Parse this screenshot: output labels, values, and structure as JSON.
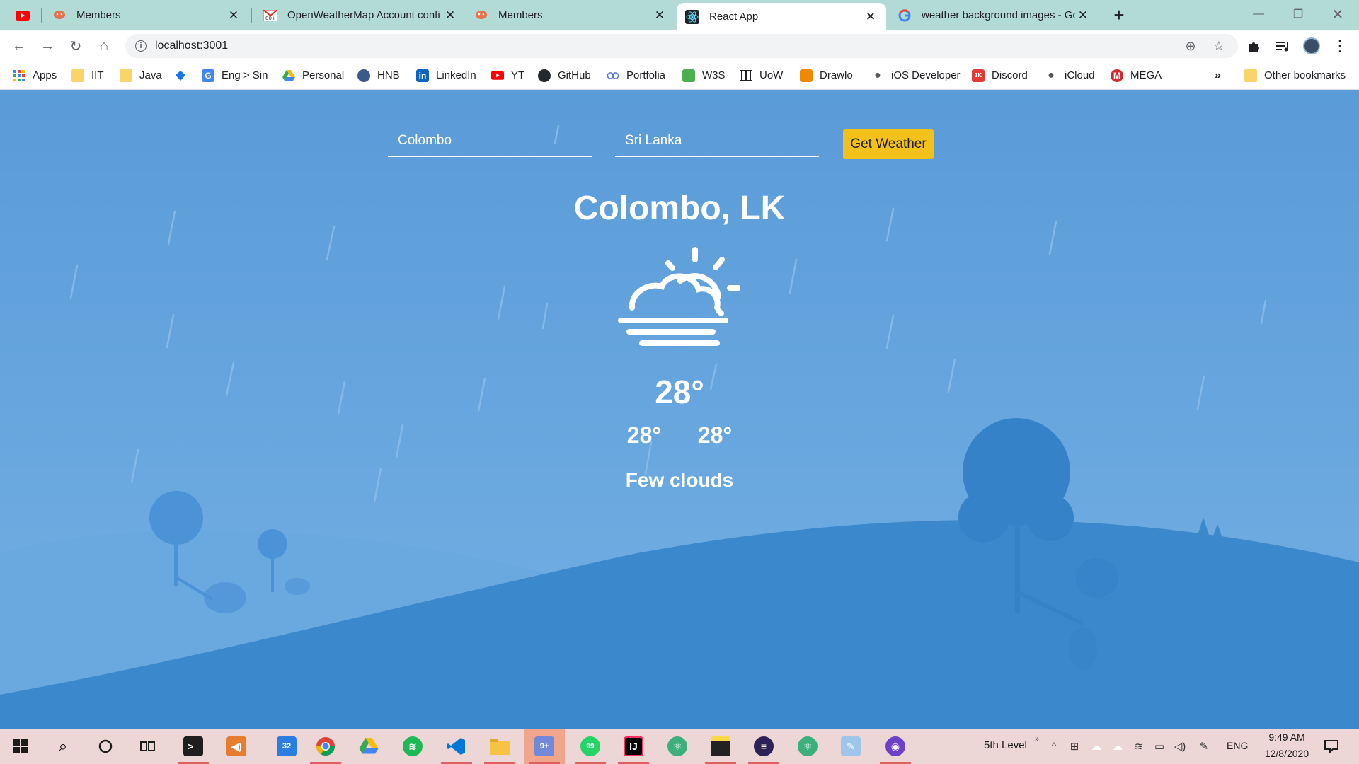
{
  "browser": {
    "tabs": [
      {
        "title": "Members",
        "favicon": "octopus-icon",
        "active": false
      },
      {
        "title": "OpenWeatherMap Account confi",
        "favicon": "gmail-icon",
        "active": false
      },
      {
        "title": "Members",
        "favicon": "octopus-icon",
        "active": false
      },
      {
        "title": "React App",
        "favicon": "react-icon",
        "active": true
      },
      {
        "title": "weather background images - Go",
        "favicon": "google-icon",
        "active": false
      }
    ],
    "address": "localhost:3001"
  },
  "bookmarks": [
    {
      "label": "Apps",
      "icon": "apps-grid-icon"
    },
    {
      "label": "IIT",
      "icon": "folder-icon"
    },
    {
      "label": "Java",
      "icon": "folder-icon"
    },
    {
      "label": "",
      "icon": "diamond-icon"
    },
    {
      "label": "Eng > Sin",
      "icon": "translate-icon"
    },
    {
      "label": "Personal",
      "icon": "google-drive-icon"
    },
    {
      "label": "HNB",
      "icon": "hnb-icon"
    },
    {
      "label": "LinkedIn",
      "icon": "linkedin-icon"
    },
    {
      "label": "YT",
      "icon": "youtube-icon"
    },
    {
      "label": "GitHub",
      "icon": "github-icon"
    },
    {
      "label": "Portfolia",
      "icon": "portfolio-icon"
    },
    {
      "label": "W3S",
      "icon": "w3s-icon"
    },
    {
      "label": "UoW",
      "icon": "uow-icon"
    },
    {
      "label": "Drawlo",
      "icon": "drawio-icon"
    },
    {
      "label": "iOS Developer",
      "icon": "apple-icon"
    },
    {
      "label": "Discord",
      "icon": "discord-icon"
    },
    {
      "label": "iCloud",
      "icon": "apple-icon"
    },
    {
      "label": "MEGA",
      "icon": "mega-icon"
    }
  ],
  "other_bookmarks": "Other bookmarks",
  "form": {
    "city": "Colombo",
    "country": "Sri Lanka",
    "button": "Get Weather"
  },
  "weather": {
    "location": "Colombo, LK",
    "icon": "partly-cloudy-day-icon",
    "temp": "28°",
    "temp_min": "28°",
    "temp_max": "28°",
    "description": "Few clouds"
  },
  "taskbar": {
    "search_badge": "32",
    "whatsapp_badge": "99",
    "notif_label": "5th Level",
    "language": "ENG",
    "time": "9:49 AM",
    "date": "12/8/2020"
  },
  "colors": {
    "sky": "#5a9bd8",
    "hill": "#3a86cb",
    "button": "#f4c01a"
  }
}
